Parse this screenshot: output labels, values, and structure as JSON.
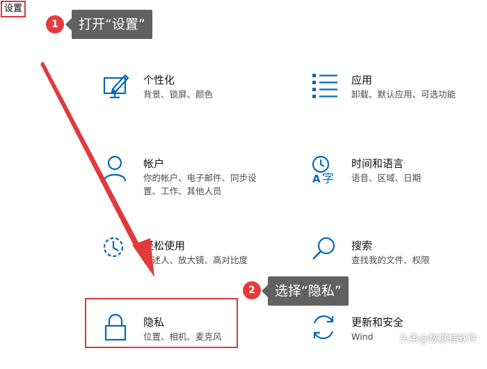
{
  "settings_tag": "设置",
  "steps": [
    {
      "number": "1",
      "text": "打开“设置”"
    },
    {
      "number": "2",
      "text": "选择“隐私”"
    }
  ],
  "tiles": {
    "personalization": {
      "title": "个性化",
      "desc": "背景、锁屏、颜色",
      "icon": "personalization-icon"
    },
    "apps": {
      "title": "应用",
      "desc": "卸载、默认应用、可选功能",
      "icon": "apps-list-icon"
    },
    "accounts": {
      "title": "帐户",
      "desc": "你的帐户、电子邮件、同步设置、工作、其他人员",
      "icon": "person-icon"
    },
    "time_language": {
      "title": "时间和语言",
      "desc": "语音、区域、日期",
      "icon": "clock-language-icon"
    },
    "ease_of_access": {
      "title": "轻松使用",
      "desc": "讲述人、放大镜、高对比度",
      "icon": "ease-of-access-icon"
    },
    "search": {
      "title": "搜索",
      "desc": "查找我的文件、权限",
      "icon": "search-icon"
    },
    "privacy": {
      "title": "隐私",
      "desc": "位置、相机、麦克风",
      "icon": "lock-icon"
    },
    "update_security": {
      "title": "更新和安全",
      "desc": "Wind",
      "icon": "update-icon"
    }
  },
  "colors": {
    "accent": "#0067b8",
    "highlight": "#d6383b",
    "callout_bg": "#616161"
  },
  "watermark": "头条@数据蛙软件"
}
